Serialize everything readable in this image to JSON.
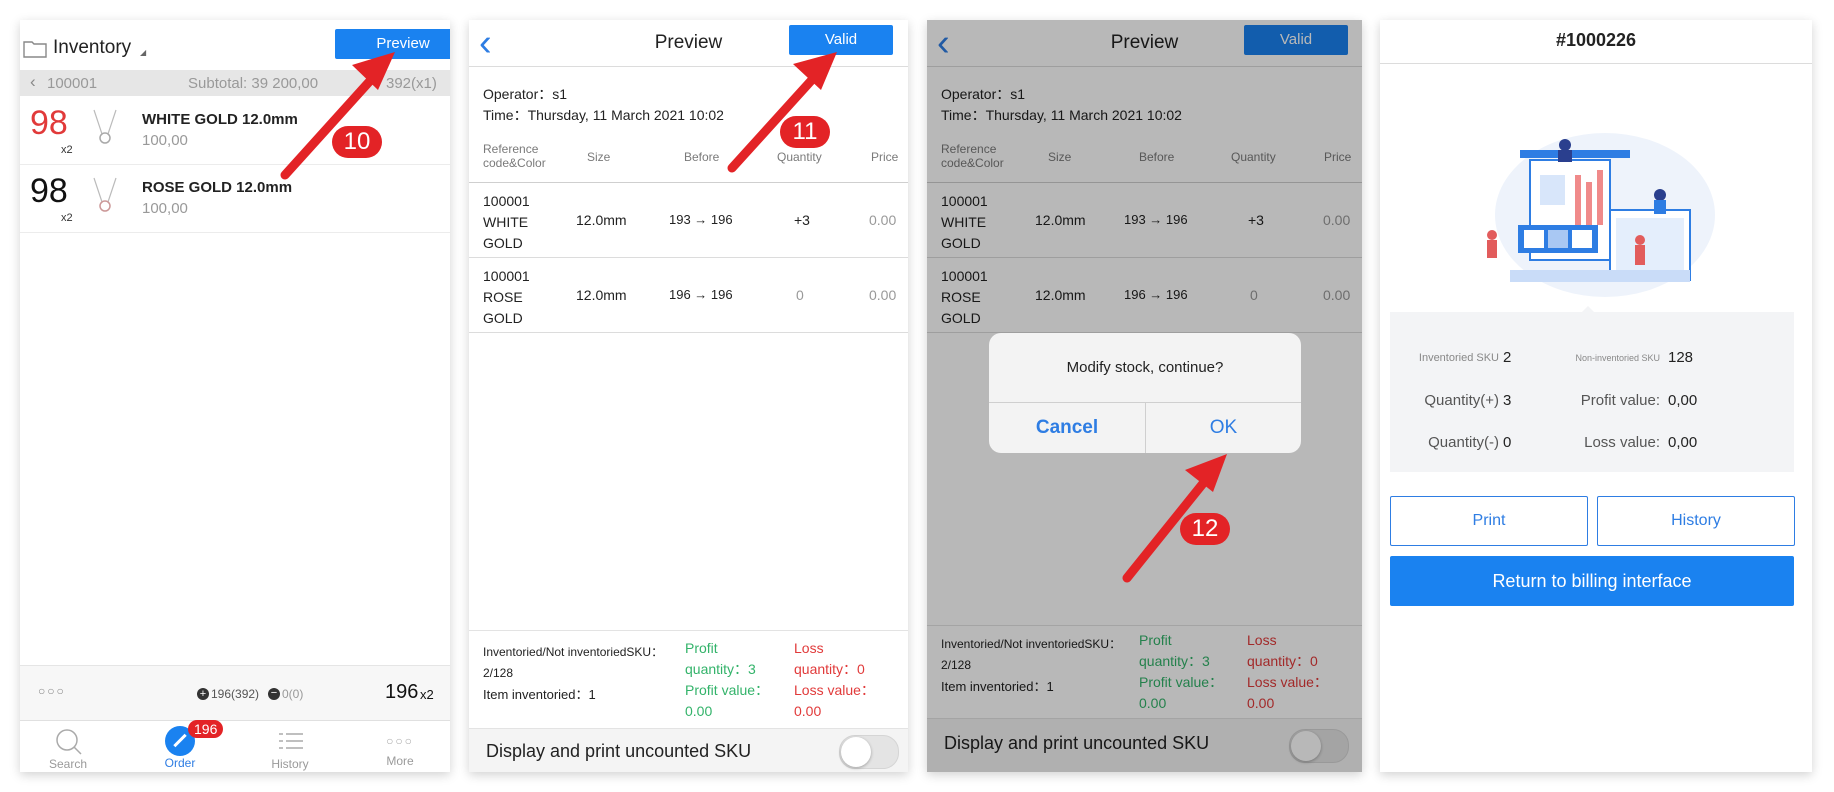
{
  "steps": {
    "step1": "10",
    "step2": "11",
    "step3": "12"
  },
  "colors": {
    "accent": "#1a82f0",
    "step_badge": "#e32326",
    "profit": "#33b36a",
    "loss": "#e13a3a",
    "arrow": "#e32326"
  },
  "panel1": {
    "title": "Inventory",
    "preview_label": "Preview",
    "back_code": "100001",
    "subtotal": "Subtotal: 39 200,00",
    "subtotal_tail": "392(x1)",
    "items": [
      {
        "qty": "98",
        "mult": "x2",
        "name": "WHITE GOLD 12.0mm",
        "price": "100,00",
        "qty_color": "red"
      },
      {
        "qty": "98",
        "mult": "x2",
        "name": "ROSE GOLD 12.0mm",
        "price": "100,00",
        "qty_color": "black"
      }
    ],
    "footer_more": "○○○",
    "footer_plus": "196(392)",
    "footer_minus": "0(0)",
    "footer_total": "196",
    "footer_total_mult": "x2",
    "tabs": [
      {
        "label": "Search",
        "icon": "search-icon"
      },
      {
        "label": "Order",
        "icon": "pencil-icon",
        "badge": "196"
      },
      {
        "label": "History",
        "icon": "list-icon"
      },
      {
        "label": "More",
        "icon": "more-icon"
      }
    ]
  },
  "preview": {
    "title": "Preview",
    "valid_label": "Valid",
    "operator": "Operator：s1",
    "time": "Time：Thursday, 11 March 2021 10:02",
    "headers": {
      "ref_line1": "Reference",
      "ref_line2": "code&Color",
      "size": "Size",
      "before": "Before",
      "quantity": "Quantity",
      "price": "Price"
    },
    "rows": [
      {
        "code": "100001",
        "line2": "WHITE",
        "line3": "GOLD",
        "size": "12.0mm",
        "before": "193 → 196",
        "quantity": "+3",
        "price": "0.00"
      },
      {
        "code": "100001",
        "line2": "ROSE",
        "line3": "GOLD",
        "size": "12.0mm",
        "before": "196 → 196",
        "quantity": "0",
        "price": "0.00"
      }
    ],
    "summary": {
      "label": "Inventoried/Not inventoriedSKU：",
      "ratio": "2/128",
      "item_inventoried": "Item inventoried：1",
      "profit_l1": "Profit",
      "profit_l2": "quantity：3",
      "profit_l3": "Profit value：",
      "profit_l4": "0.00",
      "loss_l1": "Loss",
      "loss_l2": "quantity：0",
      "loss_l3": "Loss value：",
      "loss_l4": "0.00"
    },
    "toggle_label": "Display and print uncounted SKU"
  },
  "dialog": {
    "message": "Modify stock, continue?",
    "cancel": "Cancel",
    "ok": "OK"
  },
  "result": {
    "title": "#1000226",
    "inventoried_sku_label": "Inventoried SKU",
    "inventoried_sku": "2",
    "non_inventoried_sku_label": "Non-inventoried SKU",
    "non_inventoried_sku": "128",
    "qty_plus_label": "Quantity(+)",
    "qty_plus": "3",
    "profit_value_label": "Profit value:",
    "profit_value": "0,00",
    "qty_minus_label": "Quantity(-)",
    "qty_minus": "0",
    "loss_value_label": "Loss value:",
    "loss_value": "0,00",
    "print_label": "Print",
    "history_label": "History",
    "return_label": "Return to billing interface"
  }
}
